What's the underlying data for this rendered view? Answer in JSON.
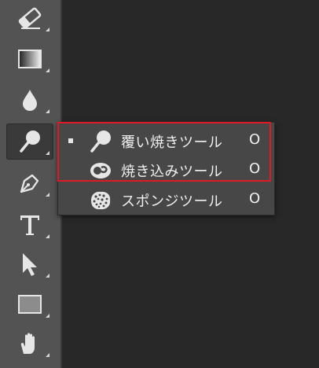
{
  "toolbar": {
    "tools": [
      {
        "name": "eraser-tool",
        "icon": "eraser-icon",
        "active": false
      },
      {
        "name": "gradient-tool",
        "icon": "gradient-icon",
        "active": false
      },
      {
        "name": "blur-tool",
        "icon": "water-drop-icon",
        "active": false
      },
      {
        "name": "dodge-tool",
        "icon": "dodge-icon",
        "active": true
      },
      {
        "name": "pen-tool",
        "icon": "pen-nib-icon",
        "active": false
      },
      {
        "name": "type-tool",
        "icon": "type-t-icon",
        "active": false
      },
      {
        "name": "path-selection-tool",
        "icon": "arrow-cursor-icon",
        "active": false
      },
      {
        "name": "rectangle-tool",
        "icon": "rectangle-icon",
        "active": false
      },
      {
        "name": "hand-tool",
        "icon": "hand-icon",
        "active": false
      }
    ]
  },
  "flyout": {
    "items": [
      {
        "label": "覆い焼きツール",
        "shortcut": "O",
        "selected": true,
        "icon": "dodge-icon"
      },
      {
        "label": "焼き込みツール",
        "shortcut": "O",
        "selected": false,
        "icon": "burn-hand-icon"
      },
      {
        "label": "スポンジツール",
        "shortcut": "O",
        "selected": false,
        "icon": "sponge-icon"
      }
    ]
  },
  "colors": {
    "highlight": "#e01a22",
    "toolbar_bg": "#535353",
    "flyout_bg": "#474747",
    "canvas_bg": "#282828"
  }
}
